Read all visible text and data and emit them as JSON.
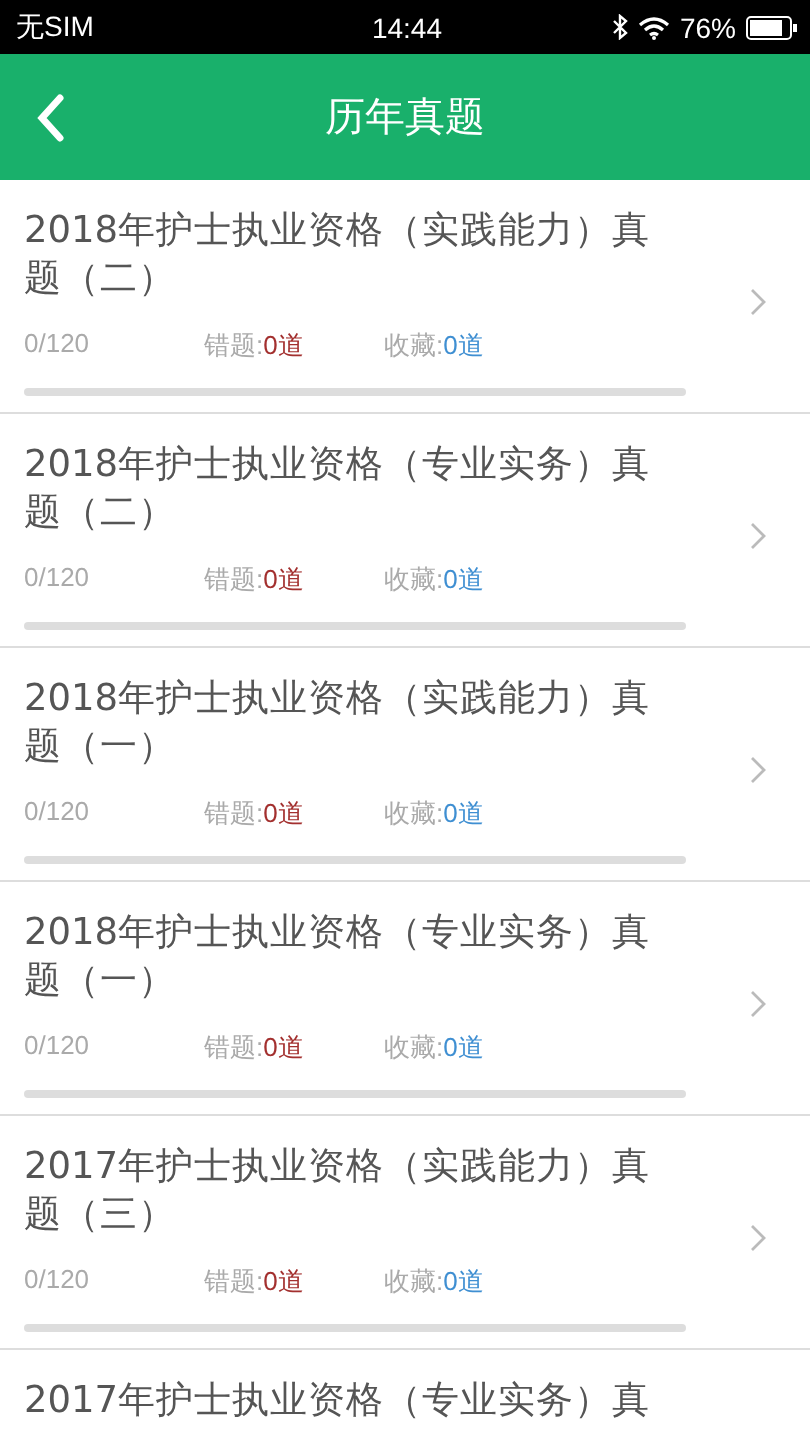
{
  "status_bar": {
    "carrier": "无SIM",
    "time": "14:44",
    "battery": "76%"
  },
  "header": {
    "title": "历年真题"
  },
  "papers": [
    {
      "title": "2018年护士执业资格（实践能力）真题（二）",
      "progress": "0/120",
      "wrong_label": "错题:",
      "wrong_count": "0道",
      "fav_label": "收藏:",
      "fav_count": "0道",
      "level": 0
    },
    {
      "title": "2018年护士执业资格（专业实务）真题（二）",
      "progress": "0/120",
      "wrong_label": "错题:",
      "wrong_count": "0道",
      "fav_label": "收藏:",
      "fav_count": "0道",
      "level": 0
    },
    {
      "title": "2018年护士执业资格（实践能力）真题（一）",
      "progress": "0/120",
      "wrong_label": "错题:",
      "wrong_count": "0道",
      "fav_label": "收藏:",
      "fav_count": "0道",
      "level": 0
    },
    {
      "title": "2018年护士执业资格（专业实务）真题（一）",
      "progress": "0/120",
      "wrong_label": "错题:",
      "wrong_count": "0道",
      "fav_label": "收藏:",
      "fav_count": "0道",
      "level": 0
    },
    {
      "title": "2017年护士执业资格（实践能力）真题（三）",
      "progress": "0/120",
      "wrong_label": "错题:",
      "wrong_count": "0道",
      "fav_label": "收藏:",
      "fav_count": "0道",
      "level": 0
    },
    {
      "title": "2017年护士执业资格（专业实务）真"
    }
  ]
}
